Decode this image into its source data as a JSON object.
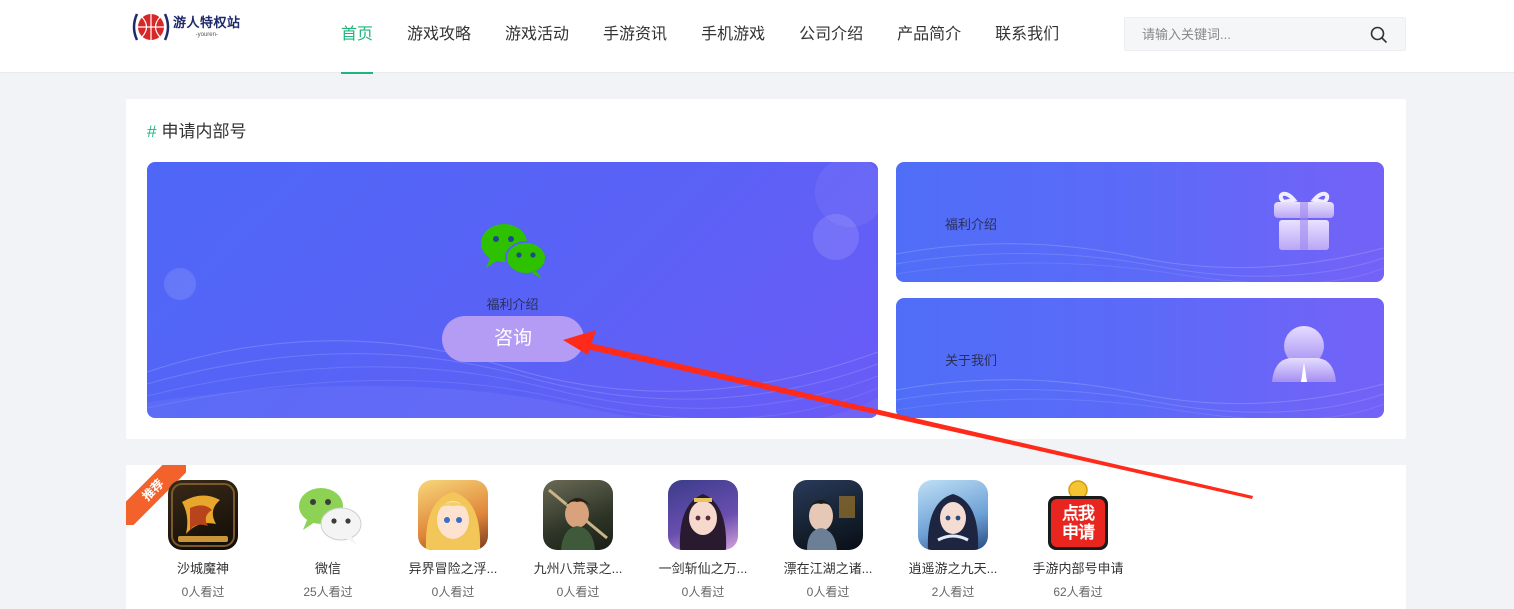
{
  "header": {
    "logo_title": "游人特权站",
    "logo_sub": "-youren-",
    "nav": [
      "首页",
      "游戏攻略",
      "游戏活动",
      "手游资讯",
      "手机游戏",
      "公司介绍",
      "产品简介",
      "联系我们"
    ],
    "active_nav": "首页",
    "search_placeholder": "请输入关键词..."
  },
  "section": {
    "hash": "#",
    "title": "申请内部号"
  },
  "big_card": {
    "label": "福利介绍",
    "button": "咨询",
    "icon": "wechat-icon"
  },
  "small_cards": [
    {
      "label": "福利介绍",
      "icon": "gift-icon"
    },
    {
      "label": "关于我们",
      "icon": "user-icon"
    }
  ],
  "ribbon": "推荐",
  "games": [
    {
      "name": "沙城魔神",
      "views": "0人看过",
      "icon": "legend-game-icon"
    },
    {
      "name": "微信",
      "views": "25人看过",
      "icon": "wechat-icon"
    },
    {
      "name": "异界冒险之浮...",
      "views": "0人看过",
      "icon": "anime-girl-icon"
    },
    {
      "name": "九州八荒录之...",
      "views": "0人看过",
      "icon": "warrior-icon"
    },
    {
      "name": "一剑斩仙之万...",
      "views": "0人看过",
      "icon": "fairy-icon"
    },
    {
      "name": "漂在江湖之诸...",
      "views": "0人看过",
      "icon": "swordsman-icon"
    },
    {
      "name": "逍遥游之九天...",
      "views": "2人看过",
      "icon": "heroine-icon"
    },
    {
      "name": "手游内部号申请",
      "views": "62人看过",
      "icon": "apply-badge-icon"
    }
  ],
  "colors": {
    "accent": "#20b57c",
    "card_blue": "#4e67f7",
    "card_purple": "#6a5bf7",
    "button": "#b49cf5",
    "ribbon": "#f2622a",
    "annotation_arrow": "#ff2a1a"
  }
}
